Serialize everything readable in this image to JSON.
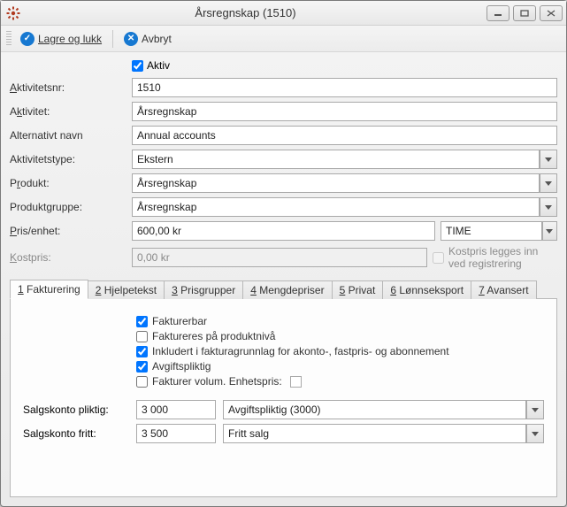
{
  "window": {
    "title": "Årsregnskap (1510)"
  },
  "toolbar": {
    "saveClose": "Lagre og lukk",
    "cancel": "Avbryt"
  },
  "form": {
    "aktivLabel": "Aktiv",
    "aktivChecked": true,
    "labels": {
      "aktivitetsnr": "Aktivitetsnr:",
      "aktivitet": "Aktivitet:",
      "altNavn": "Alternativt navn",
      "aktivitetstype": "Aktivitetstype:",
      "produkt": "Produkt:",
      "produktgruppe": "Produktgruppe:",
      "prisEnhet": "Pris/enhet:",
      "kostpris": "Kostpris:"
    },
    "values": {
      "aktivitetsnr": "1510",
      "aktivitet": "Årsregnskap",
      "altNavn": "Annual accounts",
      "aktivitetstype": "Ekstern",
      "produkt": "Årsregnskap",
      "produktgruppe": "Årsregnskap",
      "pris": "600,00 kr",
      "unit": "TIME",
      "kostpris": "0,00 kr",
      "kostprisCheckLabel": "Kostpris legges inn ved registrering"
    }
  },
  "tabs": {
    "t1": "Fakturering",
    "t2": "Hjelpetekst",
    "t3": "Prisgrupper",
    "t4": "Mengdepriser",
    "t5": "Privat",
    "t6": "Lønnseksport",
    "t7": "Avansert"
  },
  "fakturering": {
    "fakturerbar": {
      "label": "Fakturerbar",
      "checked": true
    },
    "produktniva": {
      "label": "Faktureres på produktnivå",
      "checked": false
    },
    "inkludert": {
      "label": "Inkludert i fakturagrunnlag for akonto-, fastpris- og abonnement",
      "checked": true
    },
    "avgiftspliktig": {
      "label": "Avgiftspliktig",
      "checked": true
    },
    "volum": {
      "label": "Fakturer volum. Enhetspris:",
      "checked": false,
      "value": ""
    },
    "salgPliktig": {
      "label": "Salgskonto pliktig:",
      "konto": "3 000",
      "text": "Avgiftspliktig (3000)"
    },
    "salgFritt": {
      "label": "Salgskonto fritt:",
      "konto": "3 500",
      "text": "Fritt salg"
    }
  }
}
